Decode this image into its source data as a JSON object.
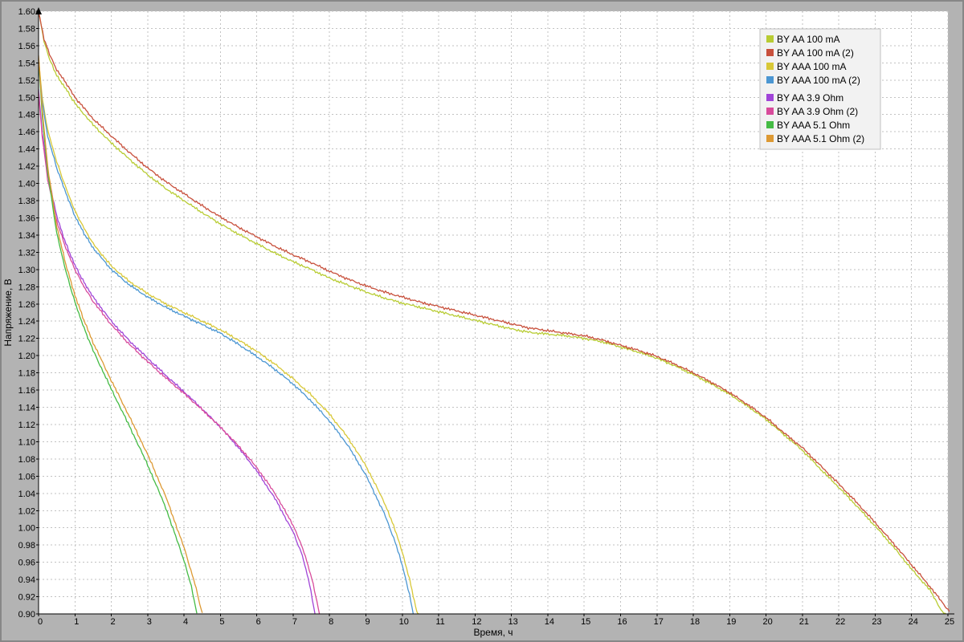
{
  "chart_data": {
    "type": "line",
    "title": "",
    "xlabel": "Время, ч",
    "ylabel": "Напряжение, В",
    "xlim": [
      0,
      25
    ],
    "ylim": [
      0.9,
      1.6
    ],
    "x_tick_step": 1,
    "y_tick_step": 0.02,
    "grid": true,
    "legend_position": "top-right",
    "series": [
      {
        "name": "BY AA 100 mA",
        "color": "#b8cc33",
        "points": [
          [
            0,
            1.6
          ],
          [
            0.15,
            1.565
          ],
          [
            0.3,
            1.545
          ],
          [
            0.5,
            1.525
          ],
          [
            0.75,
            1.51
          ],
          [
            1,
            1.493
          ],
          [
            1.5,
            1.468
          ],
          [
            2,
            1.447
          ],
          [
            2.5,
            1.428
          ],
          [
            3,
            1.41
          ],
          [
            3.5,
            1.394
          ],
          [
            4,
            1.38
          ],
          [
            4.5,
            1.366
          ],
          [
            5,
            1.353
          ],
          [
            5.5,
            1.341
          ],
          [
            6,
            1.33
          ],
          [
            6.5,
            1.319
          ],
          [
            7,
            1.309
          ],
          [
            7.5,
            1.3
          ],
          [
            8,
            1.29
          ],
          [
            8.5,
            1.282
          ],
          [
            9,
            1.274
          ],
          [
            9.5,
            1.267
          ],
          [
            10,
            1.261
          ],
          [
            10.5,
            1.256
          ],
          [
            11,
            1.251
          ],
          [
            11.5,
            1.246
          ],
          [
            12,
            1.241
          ],
          [
            12.5,
            1.236
          ],
          [
            13,
            1.231
          ],
          [
            13.5,
            1.227
          ],
          [
            14,
            1.225
          ],
          [
            14.5,
            1.223
          ],
          [
            15,
            1.22
          ],
          [
            15.5,
            1.216
          ],
          [
            16,
            1.21
          ],
          [
            16.5,
            1.204
          ],
          [
            17,
            1.197
          ],
          [
            17.5,
            1.188
          ],
          [
            18,
            1.178
          ],
          [
            18.5,
            1.167
          ],
          [
            19,
            1.155
          ],
          [
            19.5,
            1.141
          ],
          [
            20,
            1.126
          ],
          [
            20.5,
            1.108
          ],
          [
            21,
            1.09
          ],
          [
            21.5,
            1.068
          ],
          [
            22,
            1.047
          ],
          [
            22.5,
            1.025
          ],
          [
            23,
            1.002
          ],
          [
            23.5,
            0.978
          ],
          [
            24,
            0.952
          ],
          [
            24.5,
            0.928
          ],
          [
            24.85,
            0.902
          ],
          [
            24.95,
            0.9
          ]
        ]
      },
      {
        "name": "BY AA 100 mA (2)",
        "color": "#c8503c",
        "points": [
          [
            0,
            1.6
          ],
          [
            0.15,
            1.568
          ],
          [
            0.3,
            1.55
          ],
          [
            0.5,
            1.532
          ],
          [
            0.75,
            1.517
          ],
          [
            1,
            1.5
          ],
          [
            1.5,
            1.475
          ],
          [
            2,
            1.455
          ],
          [
            2.5,
            1.436
          ],
          [
            3,
            1.418
          ],
          [
            3.5,
            1.402
          ],
          [
            4,
            1.388
          ],
          [
            4.5,
            1.374
          ],
          [
            5,
            1.361
          ],
          [
            5.5,
            1.349
          ],
          [
            6,
            1.338
          ],
          [
            6.5,
            1.327
          ],
          [
            7,
            1.317
          ],
          [
            7.5,
            1.308
          ],
          [
            8,
            1.298
          ],
          [
            8.5,
            1.289
          ],
          [
            9,
            1.281
          ],
          [
            9.5,
            1.274
          ],
          [
            10,
            1.268
          ],
          [
            10.5,
            1.262
          ],
          [
            11,
            1.257
          ],
          [
            11.5,
            1.252
          ],
          [
            12,
            1.247
          ],
          [
            12.5,
            1.242
          ],
          [
            13,
            1.237
          ],
          [
            13.5,
            1.232
          ],
          [
            14,
            1.229
          ],
          [
            14.5,
            1.226
          ],
          [
            15,
            1.223
          ],
          [
            15.5,
            1.218
          ],
          [
            16,
            1.212
          ],
          [
            16.5,
            1.206
          ],
          [
            17,
            1.199
          ],
          [
            17.5,
            1.19
          ],
          [
            18,
            1.18
          ],
          [
            18.5,
            1.169
          ],
          [
            19,
            1.157
          ],
          [
            19.5,
            1.143
          ],
          [
            20,
            1.128
          ],
          [
            20.5,
            1.11
          ],
          [
            21,
            1.093
          ],
          [
            21.5,
            1.072
          ],
          [
            22,
            1.051
          ],
          [
            22.5,
            1.029
          ],
          [
            23,
            1.006
          ],
          [
            23.5,
            0.982
          ],
          [
            24,
            0.957
          ],
          [
            24.5,
            0.932
          ],
          [
            25,
            0.905
          ],
          [
            25.1,
            0.9
          ]
        ]
      },
      {
        "name": "BY AAA 100 mA",
        "color": "#d8c837",
        "points": [
          [
            0,
            1.545
          ],
          [
            0.1,
            1.5
          ],
          [
            0.25,
            1.462
          ],
          [
            0.5,
            1.425
          ],
          [
            0.75,
            1.395
          ],
          [
            1,
            1.368
          ],
          [
            1.25,
            1.348
          ],
          [
            1.5,
            1.33
          ],
          [
            2,
            1.304
          ],
          [
            2.5,
            1.286
          ],
          [
            3,
            1.272
          ],
          [
            3.5,
            1.26
          ],
          [
            4,
            1.25
          ],
          [
            4.5,
            1.24
          ],
          [
            5,
            1.23
          ],
          [
            5.5,
            1.218
          ],
          [
            6,
            1.205
          ],
          [
            6.5,
            1.19
          ],
          [
            7,
            1.173
          ],
          [
            7.5,
            1.154
          ],
          [
            8,
            1.132
          ],
          [
            8.5,
            1.105
          ],
          [
            9,
            1.072
          ],
          [
            9.5,
            1.03
          ],
          [
            9.8,
            0.998
          ],
          [
            10,
            0.972
          ],
          [
            10.2,
            0.94
          ],
          [
            10.4,
            0.902
          ],
          [
            10.45,
            0.9
          ]
        ]
      },
      {
        "name": "BY AAA 100 mA (2)",
        "color": "#4b96d2",
        "points": [
          [
            0,
            1.54
          ],
          [
            0.1,
            1.495
          ],
          [
            0.25,
            1.455
          ],
          [
            0.5,
            1.418
          ],
          [
            0.75,
            1.389
          ],
          [
            1,
            1.362
          ],
          [
            1.25,
            1.342
          ],
          [
            1.5,
            1.325
          ],
          [
            2,
            1.3
          ],
          [
            2.5,
            1.282
          ],
          [
            3,
            1.268
          ],
          [
            3.5,
            1.256
          ],
          [
            4,
            1.246
          ],
          [
            4.5,
            1.236
          ],
          [
            5,
            1.226
          ],
          [
            5.5,
            1.213
          ],
          [
            6,
            1.199
          ],
          [
            6.5,
            1.184
          ],
          [
            7,
            1.167
          ],
          [
            7.5,
            1.147
          ],
          [
            8,
            1.124
          ],
          [
            8.5,
            1.096
          ],
          [
            9,
            1.061
          ],
          [
            9.5,
            1.017
          ],
          [
            9.8,
            0.984
          ],
          [
            10,
            0.956
          ],
          [
            10.2,
            0.922
          ],
          [
            10.3,
            0.9
          ]
        ]
      },
      {
        "name": "BY AA 3.9 Ohm",
        "color": "#a044d8",
        "points": [
          [
            0,
            1.508
          ],
          [
            0.1,
            1.46
          ],
          [
            0.25,
            1.412
          ],
          [
            0.5,
            1.362
          ],
          [
            0.75,
            1.33
          ],
          [
            1,
            1.305
          ],
          [
            1.25,
            1.285
          ],
          [
            1.5,
            1.268
          ],
          [
            2,
            1.24
          ],
          [
            2.5,
            1.217
          ],
          [
            3,
            1.197
          ],
          [
            3.5,
            1.177
          ],
          [
            4,
            1.158
          ],
          [
            4.5,
            1.138
          ],
          [
            5,
            1.117
          ],
          [
            5.5,
            1.093
          ],
          [
            6,
            1.066
          ],
          [
            6.5,
            1.034
          ],
          [
            7,
            0.995
          ],
          [
            7.25,
            0.968
          ],
          [
            7.45,
            0.935
          ],
          [
            7.6,
            0.9
          ]
        ]
      },
      {
        "name": "BY AA 3.9 Ohm (2)",
        "color": "#d84b9b",
        "points": [
          [
            0,
            1.505
          ],
          [
            0.1,
            1.455
          ],
          [
            0.25,
            1.405
          ],
          [
            0.5,
            1.356
          ],
          [
            0.75,
            1.325
          ],
          [
            1,
            1.3
          ],
          [
            1.25,
            1.28
          ],
          [
            1.5,
            1.263
          ],
          [
            2,
            1.236
          ],
          [
            2.5,
            1.213
          ],
          [
            3,
            1.193
          ],
          [
            3.5,
            1.174
          ],
          [
            4,
            1.156
          ],
          [
            4.5,
            1.137
          ],
          [
            5,
            1.117
          ],
          [
            5.5,
            1.095
          ],
          [
            6,
            1.07
          ],
          [
            6.5,
            1.04
          ],
          [
            7,
            1.003
          ],
          [
            7.3,
            0.972
          ],
          [
            7.55,
            0.935
          ],
          [
            7.72,
            0.9
          ]
        ]
      },
      {
        "name": "BY AAA 5.1 Ohm",
        "color": "#44bb44",
        "points": [
          [
            0,
            1.545
          ],
          [
            0.1,
            1.48
          ],
          [
            0.25,
            1.413
          ],
          [
            0.5,
            1.342
          ],
          [
            0.75,
            1.298
          ],
          [
            1,
            1.262
          ],
          [
            1.25,
            1.232
          ],
          [
            1.5,
            1.206
          ],
          [
            2,
            1.161
          ],
          [
            2.5,
            1.118
          ],
          [
            3,
            1.073
          ],
          [
            3.5,
            1.023
          ],
          [
            4,
            0.962
          ],
          [
            4.2,
            0.932
          ],
          [
            4.35,
            0.9
          ]
        ]
      },
      {
        "name": "BY AAA 5.1 Ohm (2)",
        "color": "#dd9933",
        "points": [
          [
            0,
            1.55
          ],
          [
            0.1,
            1.487
          ],
          [
            0.25,
            1.42
          ],
          [
            0.5,
            1.35
          ],
          [
            0.75,
            1.306
          ],
          [
            1,
            1.27
          ],
          [
            1.25,
            1.241
          ],
          [
            1.5,
            1.215
          ],
          [
            2,
            1.171
          ],
          [
            2.5,
            1.129
          ],
          [
            3,
            1.085
          ],
          [
            3.5,
            1.036
          ],
          [
            4,
            0.977
          ],
          [
            4.3,
            0.935
          ],
          [
            4.5,
            0.9
          ]
        ]
      }
    ]
  },
  "colors": {
    "background": "#b3b3b3",
    "plot_bg": "#ffffff",
    "grid": "#c2c2c2",
    "axis": "#000000",
    "tick_text": "#000000",
    "legend_bg": "#f2f2f2",
    "legend_border": "#c0c0c0"
  }
}
